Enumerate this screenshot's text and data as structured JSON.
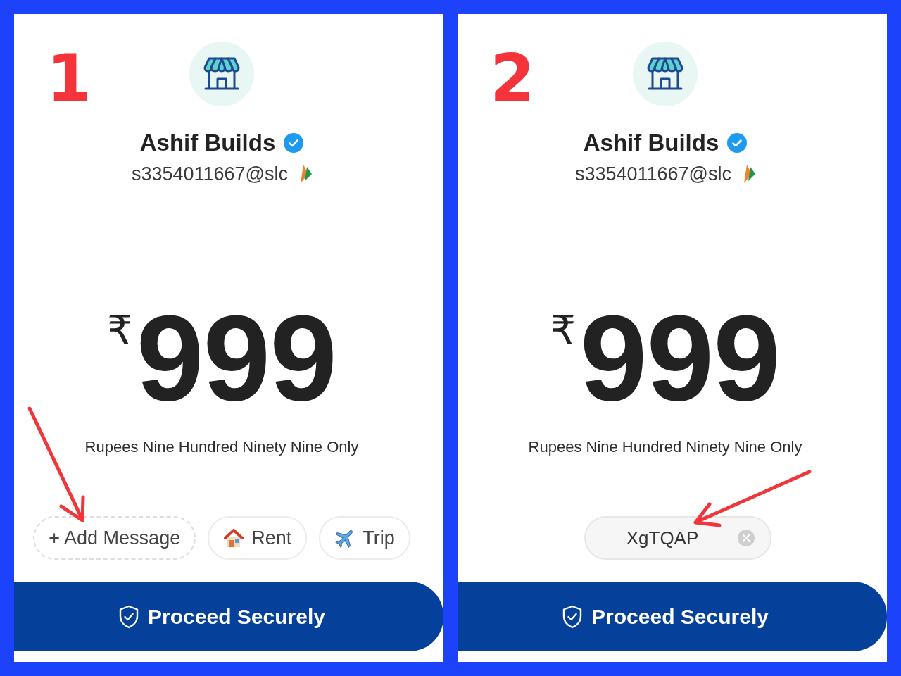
{
  "panels": [
    {
      "step": "1",
      "merchant": {
        "name": "Ashif Builds",
        "verified": true,
        "upi_id": "s3354011667@slc"
      },
      "amount": {
        "currency": "₹",
        "value": "999",
        "in_words": "Rupees Nine Hundred Ninety Nine Only"
      },
      "message_chips": [
        {
          "kind": "add",
          "label": "+ Add Message"
        },
        {
          "kind": "house",
          "label": "Rent"
        },
        {
          "kind": "plane",
          "label": "Trip"
        }
      ],
      "button": {
        "label": "Proceed Securely"
      },
      "annotation_arrow": {
        "kind": "southeast"
      }
    },
    {
      "step": "2",
      "merchant": {
        "name": "Ashif Builds",
        "verified": true,
        "upi_id": "s3354011667@slc"
      },
      "amount": {
        "currency": "₹",
        "value": "999",
        "in_words": "Rupees Nine Hundred Ninety Nine Only"
      },
      "message_field": {
        "value": "XgTQAP"
      },
      "button": {
        "label": "Proceed Securely"
      },
      "annotation_arrow": {
        "kind": "southwest"
      }
    }
  ]
}
